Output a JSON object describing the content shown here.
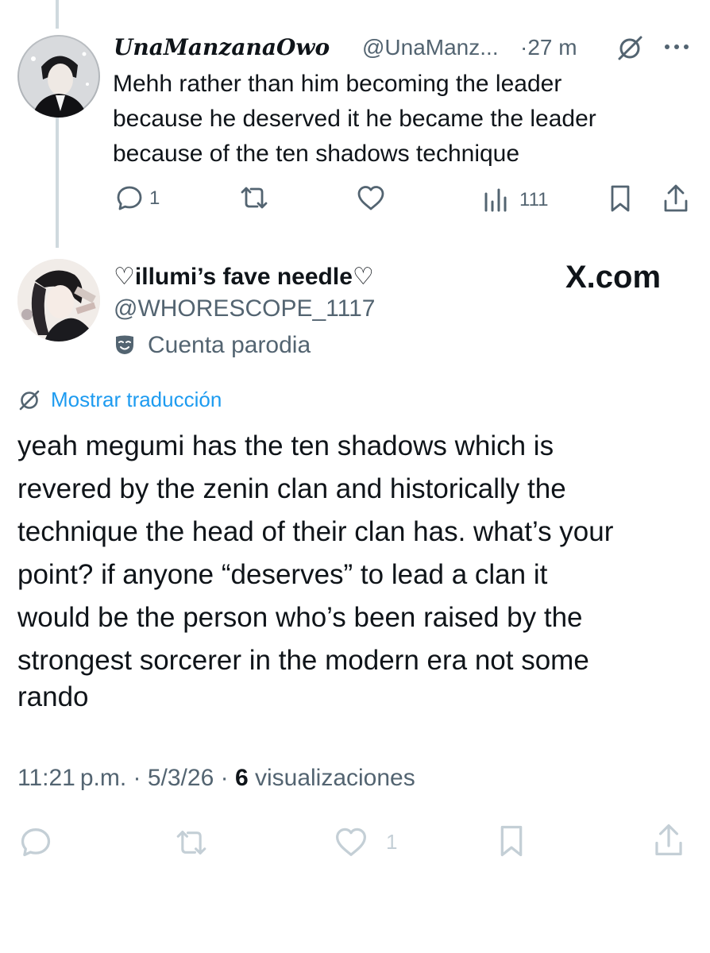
{
  "reply_tweet": {
    "display_name": "UnaManzanaOwo",
    "handle": "@UnaManz...",
    "time": "·27 m",
    "text_lines": [
      "Mehh rather than him becoming the leader",
      "because he deserved it he became the leader",
      "because of the ten shadows technique"
    ],
    "actions": {
      "reply_count": "1",
      "views_count": "111"
    }
  },
  "main_tweet": {
    "display_name": "♡illumi’s fave needle♡",
    "handle": "@WHORESCOPE_1117",
    "parody_label": "Cuenta parodia",
    "translate_label": "Mostrar traducción",
    "text_lines": [
      "yeah megumi has the ten shadows which is",
      "revered by the zenin clan and historically the",
      "technique the head of their clan has. what’s your",
      "point? if anyone “deserves” to lead a clan it",
      "would be the person who’s been raised by the",
      "strongest sorcerer in the modern era not some",
      "rando"
    ],
    "timestamp": "11:21 p.m. · 5/3/26 ·",
    "views_count": "6",
    "views_label": "visualizaciones",
    "actions": {
      "like_count": "1"
    }
  },
  "watermark": "X.com",
  "icons": {
    "reply": "comment-icon",
    "repost": "retweet-icon",
    "like": "heart-icon",
    "views": "views-chart-icon",
    "bookmark": "bookmark-icon",
    "share": "share-icon",
    "grok": "grok-icon",
    "more": "more-dots-icon",
    "parody": "mask-icon",
    "translate": "translate-icon"
  },
  "colors": {
    "text": "#0f1419",
    "secondary": "#536471",
    "link": "#1d9bf0",
    "thread_line": "#cfd9de",
    "faded_actions": "#c4cfd6"
  }
}
